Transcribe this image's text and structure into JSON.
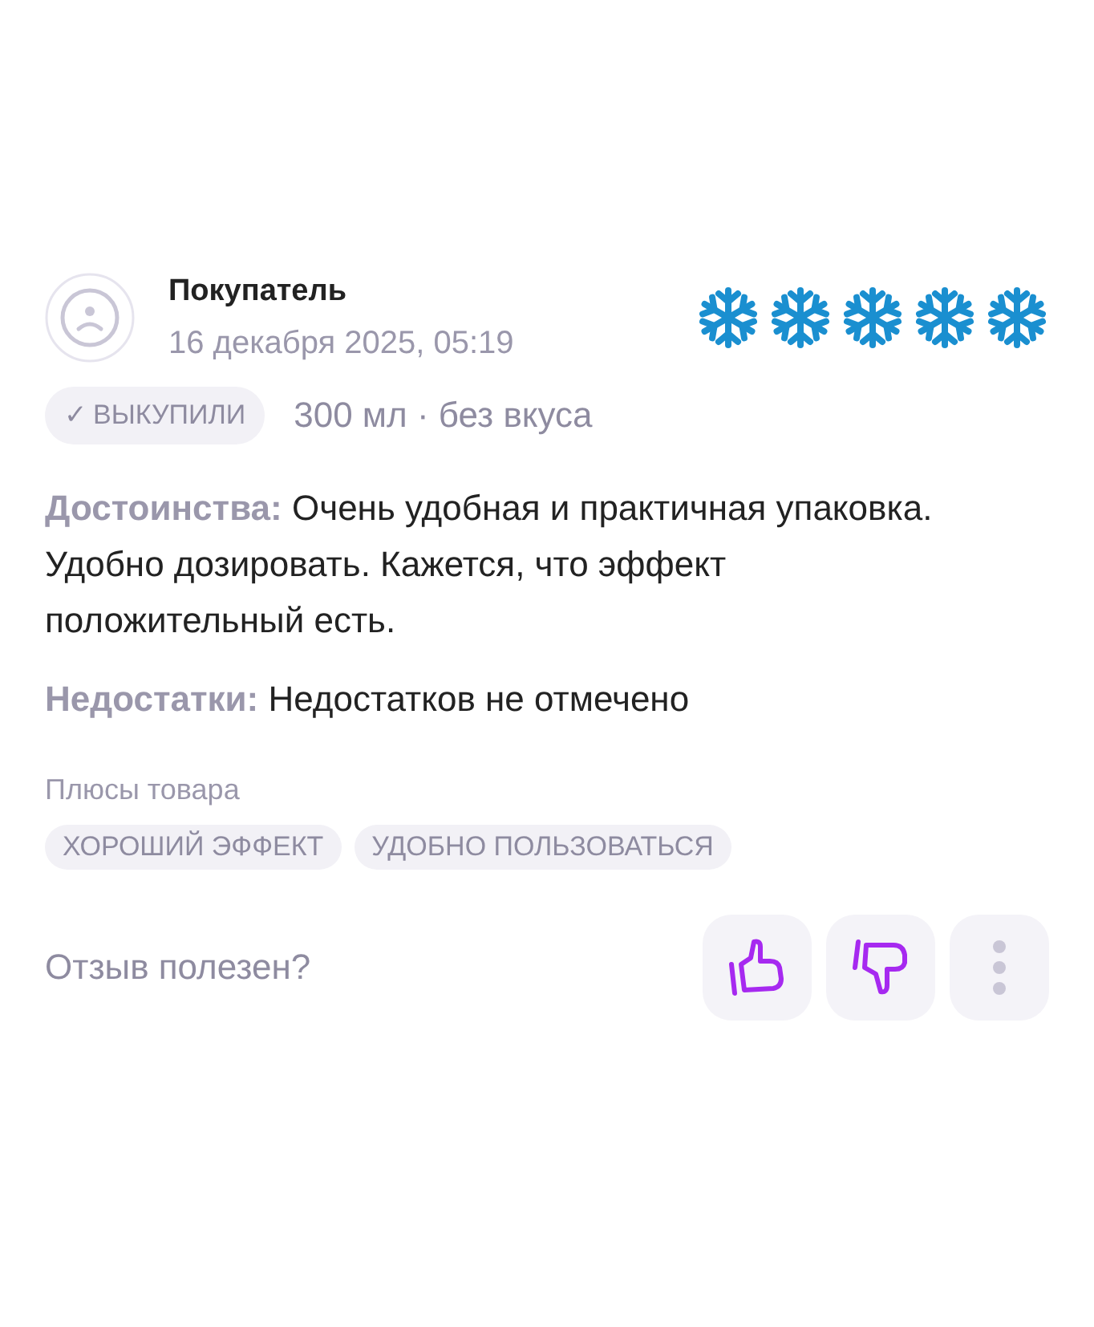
{
  "review": {
    "author": "Покупатель",
    "date": "16 декабря 2025, 05:19",
    "stars": 5,
    "badge": {
      "check": "✓",
      "label": "ВЫКУПИЛИ"
    },
    "variant": "300 мл · без вкуса",
    "sections": [
      {
        "label": "Достоинства:",
        "text": "Очень удобная и практичная упаковка. Удобно дозировать. Кажется, что эффект положительный есть."
      },
      {
        "label": "Недостатки:",
        "text": "Недостатков не отмечено"
      }
    ],
    "tags_title": "Плюсы товара",
    "tags": [
      "ХОРОШИЙ ЭФФЕКТ",
      "УДОБНО ПОЛЬЗОВАТЬСЯ"
    ],
    "helpful_prompt": "Отзыв полезен?"
  }
}
